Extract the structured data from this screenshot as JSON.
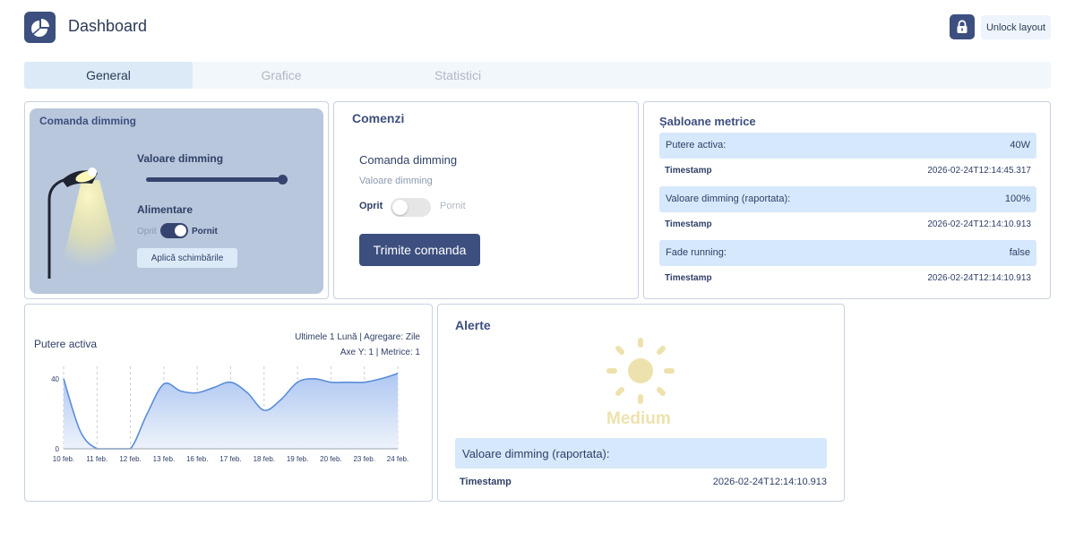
{
  "header": {
    "title": "Dashboard",
    "unlock_label": "Unlock layout"
  },
  "tabs": [
    {
      "label": "General",
      "active": true
    },
    {
      "label": "Grafice",
      "active": false
    },
    {
      "label": "Statistici",
      "active": false
    }
  ],
  "dimming_widget": {
    "title": "Comanda dimming",
    "dimming_label": "Valoare dimming",
    "dimming_value_percent": 100,
    "power_label": "Alimentare",
    "off_label": "Oprit",
    "on_label": "Pornit",
    "power_on": true,
    "apply_label": "Aplică schimbările"
  },
  "commands": {
    "title": "Comenzi",
    "subtitle": "Comanda dimming",
    "field_label": "Valoare dimming",
    "off_label": "Oprit",
    "on_label": "Pornit",
    "toggle_on": false,
    "send_label": "Trimite comanda"
  },
  "metric_templates": {
    "title": "Șabloane metrice",
    "items": [
      {
        "key": "Putere activa:",
        "value": "40W",
        "ts_label": "Timestamp",
        "ts_value": "2026-02-24T12:14:45.317"
      },
      {
        "key": "Valoare dimming (raportata):",
        "value": "100%",
        "ts_label": "Timestamp",
        "ts_value": "2026-02-24T12:14:10.913"
      },
      {
        "key": "Fade running:",
        "value": "false",
        "ts_label": "Timestamp",
        "ts_value": "2026-02-24T12:14:10.913"
      }
    ]
  },
  "chart_card": {
    "meta_line1": "Ultimele 1 Lună | Agregare: Zile",
    "meta_line2": "Axe Y: 1 | Metrice: 1"
  },
  "chart_data": {
    "type": "area",
    "title": "Putere activa",
    "x": [
      "10 feb.",
      "10.5",
      "11 feb.",
      "11.5",
      "12 feb.",
      "12.5",
      "13 feb.",
      "14.5",
      "16 feb.",
      "16.5",
      "17 feb.",
      "17.5",
      "18 feb.",
      "18.5",
      "19 feb.",
      "19.5",
      "20 feb.",
      "21.5",
      "23 feb.",
      "23.5",
      "24 feb."
    ],
    "tick_labels": [
      "10 feb.",
      "11 feb.",
      "12 feb.",
      "13 feb.",
      "16 feb.",
      "17 feb.",
      "18 feb.",
      "19 feb.",
      "20 feb.",
      "23 feb.",
      "24 feb."
    ],
    "values": [
      40,
      10,
      0,
      0,
      0,
      20,
      37,
      33,
      32,
      35,
      38,
      32,
      22,
      28,
      38,
      40,
      38,
      38,
      38,
      40,
      43
    ],
    "yticks": [
      0,
      40
    ],
    "ylim": [
      0,
      45
    ],
    "colors": {
      "line": "#5b8dd9",
      "fill_top": "#aec7f2",
      "fill_bottom": "#eef3fb"
    },
    "grid": "vertical dashed"
  },
  "alerts": {
    "title": "Alerte",
    "icon": "sun-icon",
    "level": "Medium",
    "metric_label": "Valoare dimming (raportata):",
    "ts_label": "Timestamp",
    "ts_value": "2026-02-24T12:14:10.913"
  }
}
